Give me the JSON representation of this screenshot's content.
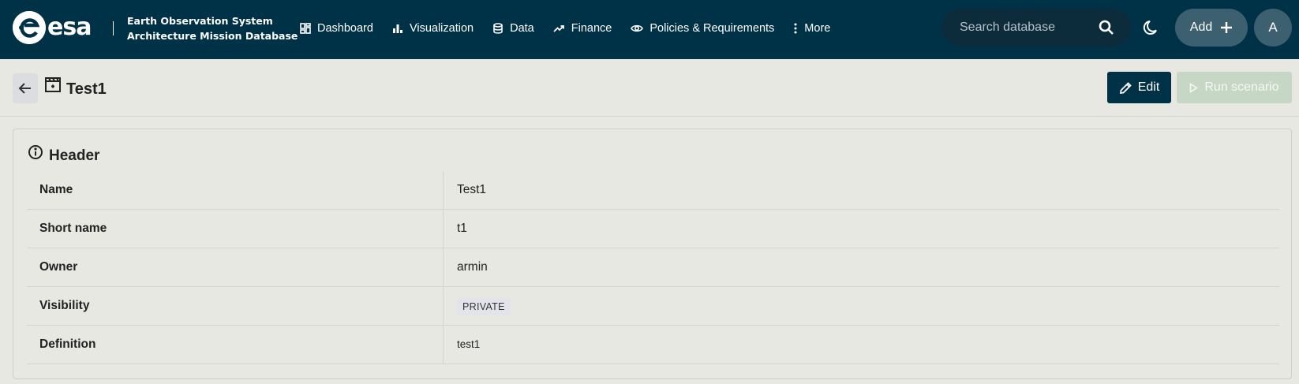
{
  "brand": {
    "logo_text": "esa",
    "app_title_line1": "Earth Observation System",
    "app_title_line2": "Architecture Mission Database"
  },
  "nav": {
    "items": [
      {
        "label": "Dashboard",
        "icon": "dashboard-icon"
      },
      {
        "label": "Visualization",
        "icon": "bar-chart-icon"
      },
      {
        "label": "Data",
        "icon": "database-icon"
      },
      {
        "label": "Finance",
        "icon": "trending-up-icon"
      },
      {
        "label": "Policies & Requirements",
        "icon": "eye-icon"
      },
      {
        "label": "More",
        "icon": "more-vertical-icon"
      }
    ]
  },
  "search": {
    "placeholder": "Search database",
    "value": ""
  },
  "actions": {
    "add_label": "Add",
    "avatar_initial": "A"
  },
  "page": {
    "title": "Test1",
    "edit_label": "Edit",
    "run_label": "Run scenario"
  },
  "card": {
    "title": "Header",
    "rows": [
      {
        "label": "Name",
        "value": "Test1"
      },
      {
        "label": "Short name",
        "value": "t1"
      },
      {
        "label": "Owner",
        "value": "armin"
      },
      {
        "label": "Visibility",
        "value": "PRIVATE"
      },
      {
        "label": "Definition",
        "value": "test1"
      }
    ]
  },
  "colors": {
    "topbar": "#003247",
    "background": "#e8e8e3",
    "primary_button": "#003247",
    "disabled_button": "#c6d8c5",
    "pill": "#3d6070"
  }
}
